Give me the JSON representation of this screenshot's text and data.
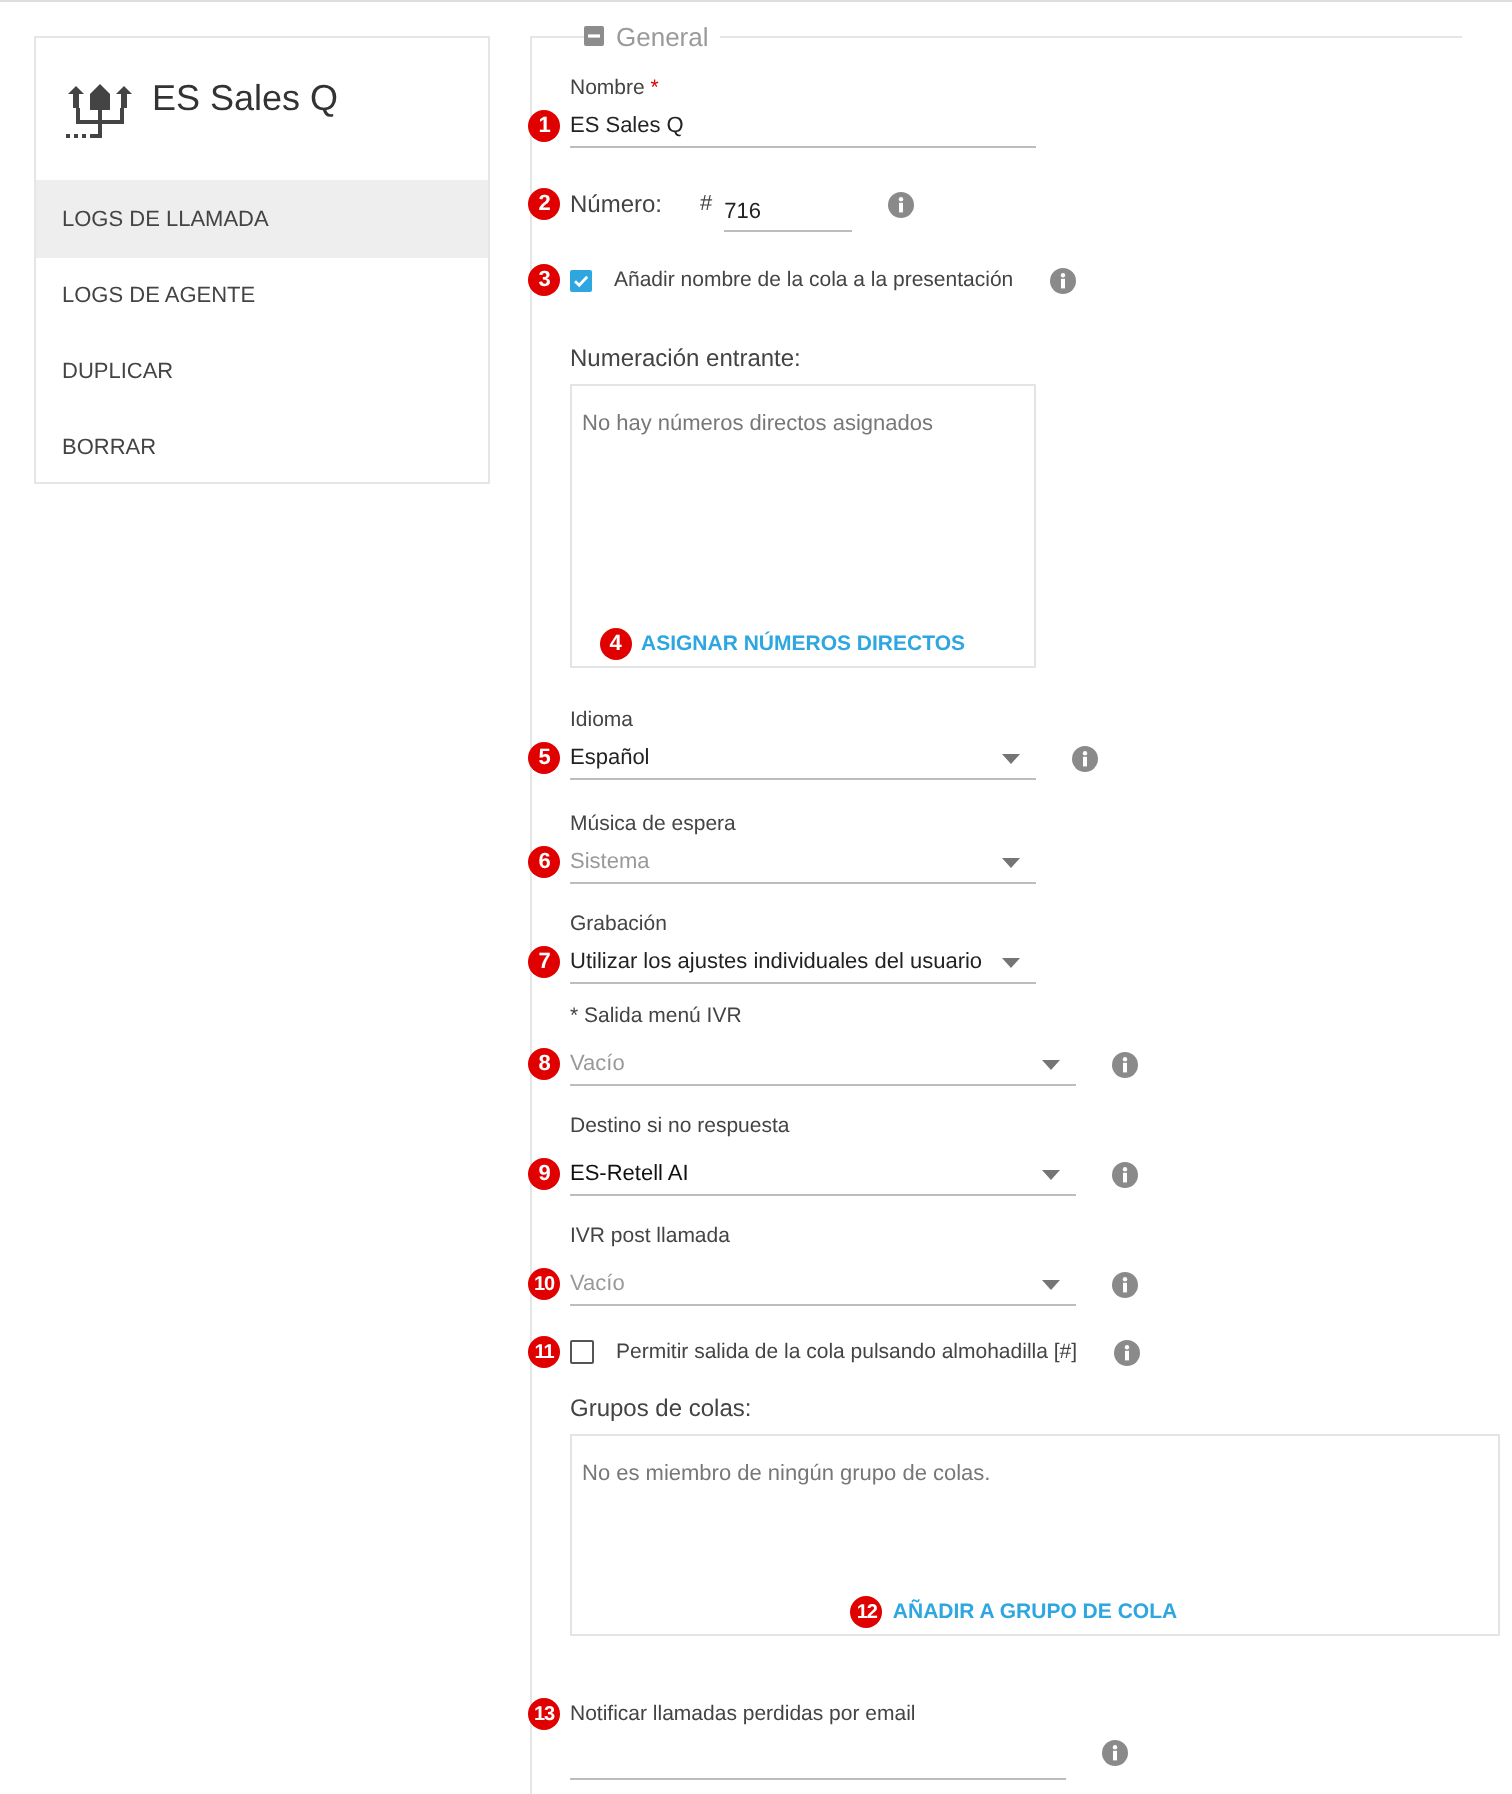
{
  "sidebar": {
    "title": "ES Sales Q",
    "items": [
      {
        "label": "LOGS DE LLAMADA",
        "selected": true
      },
      {
        "label": "LOGS DE AGENTE",
        "selected": false
      },
      {
        "label": "DUPLICAR",
        "selected": false
      },
      {
        "label": "BORRAR",
        "selected": false
      }
    ]
  },
  "section": {
    "title": "General",
    "expanded": true
  },
  "fields": [
    {
      "kind": "text",
      "marker": "1",
      "label": "Nombre",
      "required_mark": "*",
      "value": "ES Sales Q"
    },
    {
      "kind": "number",
      "marker": "2",
      "label": "Número:",
      "prefix": "#",
      "value": "716",
      "info": true
    },
    {
      "kind": "checkbox",
      "marker": "3",
      "label": "Añadir nombre de la cola a la presentación",
      "checked": true,
      "info": true
    },
    {
      "kind": "list",
      "marker": "4",
      "label": "Numeración entrante:",
      "message": "No hay números directos asignados",
      "action": "ASIGNAR NÚMEROS DIRECTOS"
    },
    {
      "kind": "select",
      "marker": "5",
      "label": "Idioma",
      "value": "Español",
      "info": true
    },
    {
      "kind": "select",
      "marker": "6",
      "label": "Música de espera",
      "placeholder": "Sistema"
    },
    {
      "kind": "select",
      "marker": "7",
      "label": "Grabación",
      "value": "Utilizar los ajustes individuales del usuario"
    },
    {
      "kind": "select",
      "marker": "8",
      "label": "* Salida menú IVR",
      "placeholder": "Vacío",
      "info": true
    },
    {
      "kind": "select",
      "marker": "9",
      "label": "Destino si no respuesta",
      "value": "ES-Retell AI",
      "info": true
    },
    {
      "kind": "select",
      "marker": "10",
      "label": "IVR post llamada",
      "placeholder": "Vacío",
      "info": true
    },
    {
      "kind": "checkbox",
      "marker": "11",
      "label": "Permitir salida de la cola pulsando almohadilla [#]",
      "checked": false,
      "info": true
    },
    {
      "kind": "list",
      "marker": "12",
      "label": "Grupos de colas:",
      "message": "No es miembro de ningún grupo de colas.",
      "action": "AÑADIR A GRUPO DE COLA"
    },
    {
      "kind": "email",
      "marker": "13",
      "label": "Notificar llamadas perdidas por email",
      "info": true
    }
  ]
}
